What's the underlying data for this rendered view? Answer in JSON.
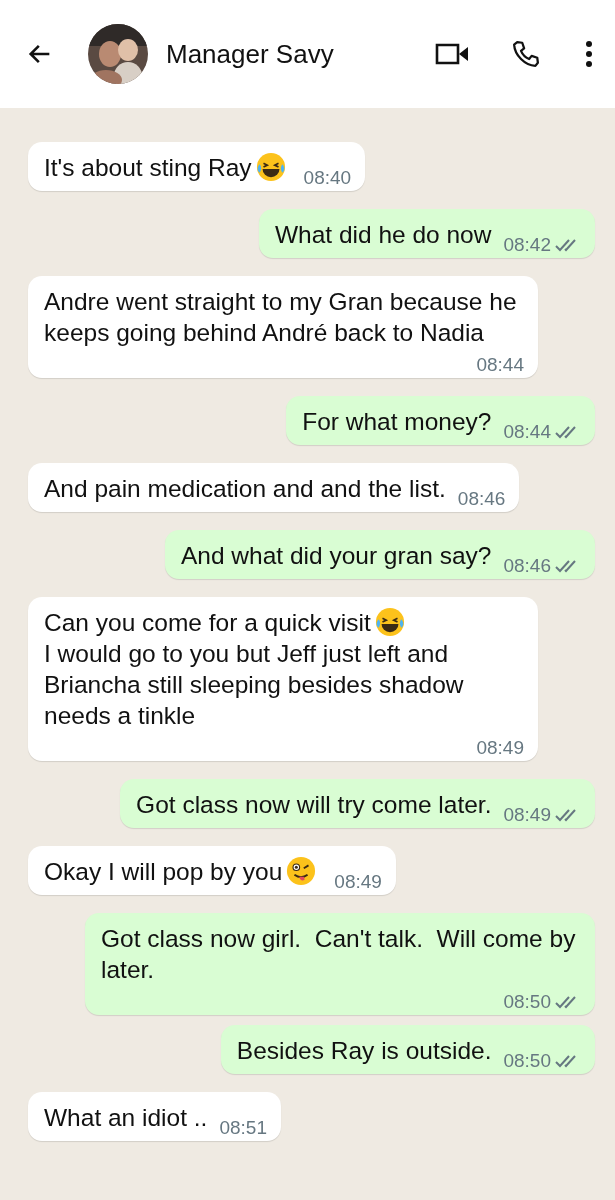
{
  "header": {
    "title": "Manager Savy"
  },
  "messages": [
    {
      "outgoing": false,
      "parts": [
        {
          "kind": "text",
          "text": "It's about sting Ray"
        },
        {
          "kind": "emoji-laugh"
        }
      ],
      "time": "08:40"
    },
    {
      "outgoing": true,
      "parts": [
        {
          "kind": "text",
          "text": "What did he do now"
        }
      ],
      "time": "08:42",
      "read": false
    },
    {
      "outgoing": false,
      "parts": [
        {
          "kind": "text",
          "text": "Andre went straight to my Gran because he keeps going behind André back to Nadia"
        }
      ],
      "time": "08:44"
    },
    {
      "outgoing": true,
      "parts": [
        {
          "kind": "text",
          "text": "For what money?"
        }
      ],
      "time": "08:44",
      "read": false
    },
    {
      "outgoing": false,
      "parts": [
        {
          "kind": "text",
          "text": "And pain medication and and the list."
        }
      ],
      "time": "08:46"
    },
    {
      "outgoing": true,
      "parts": [
        {
          "kind": "text",
          "text": "And what did your gran say?"
        }
      ],
      "time": "08:46",
      "read": false
    },
    {
      "outgoing": false,
      "parts": [
        {
          "kind": "text",
          "text": "Can you come for a quick visit"
        },
        {
          "kind": "emoji-laugh"
        },
        {
          "kind": "text",
          "text": "I would go to you but Jeff just left and Briancha still sleeping besides shadow needs a tinkle"
        }
      ],
      "time": "08:49"
    },
    {
      "outgoing": true,
      "parts": [
        {
          "kind": "text",
          "text": "Got class now will try come later."
        }
      ],
      "time": "08:49",
      "read": false
    },
    {
      "outgoing": false,
      "parts": [
        {
          "kind": "text",
          "text": "Okay I will pop by you"
        },
        {
          "kind": "emoji-wink"
        }
      ],
      "time": "08:49"
    },
    {
      "outgoing": true,
      "parts": [
        {
          "kind": "text",
          "text": "Got class now girl.  Can't talk.  Will come by later."
        }
      ],
      "time": "08:50",
      "read": false
    },
    {
      "outgoing": true,
      "parts": [
        {
          "kind": "text",
          "text": "Besides Ray is outside."
        }
      ],
      "time": "08:50",
      "read": false
    },
    {
      "outgoing": false,
      "parts": [
        {
          "kind": "text",
          "text": "What an idiot .."
        }
      ],
      "time": "08:51"
    }
  ]
}
